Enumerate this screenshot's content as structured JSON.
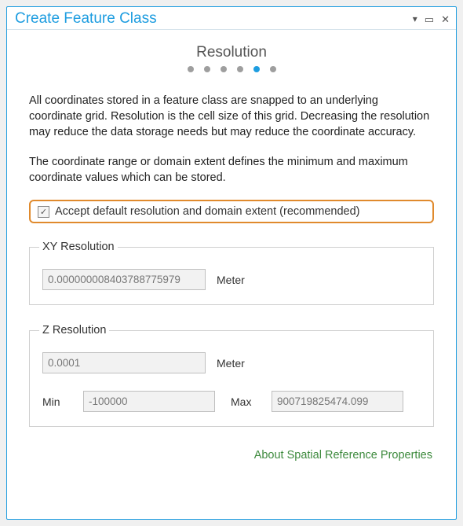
{
  "window": {
    "title": "Create Feature Class"
  },
  "step": {
    "title": "Resolution",
    "active_index": 4,
    "total": 6
  },
  "paragraphs": {
    "p1": "All coordinates stored in a feature class are snapped to an underlying coordinate grid. Resolution is the cell size of this grid. Decreasing the resolution may reduce the data storage needs but may reduce the coordinate accuracy.",
    "p2": "The coordinate range or domain extent defines the minimum and maximum coordinate values which can be stored."
  },
  "accept_default": {
    "checked": true,
    "label": "Accept default resolution and domain extent (recommended)"
  },
  "xy": {
    "legend": "XY Resolution",
    "value": "0.000000008403788775979",
    "unit": "Meter"
  },
  "z": {
    "legend": "Z Resolution",
    "value": "0.0001",
    "unit": "Meter",
    "min_label": "Min",
    "min_value": "-100000",
    "max_label": "Max",
    "max_value": "900719825474.099"
  },
  "footer": {
    "link": "About Spatial Reference Properties"
  }
}
